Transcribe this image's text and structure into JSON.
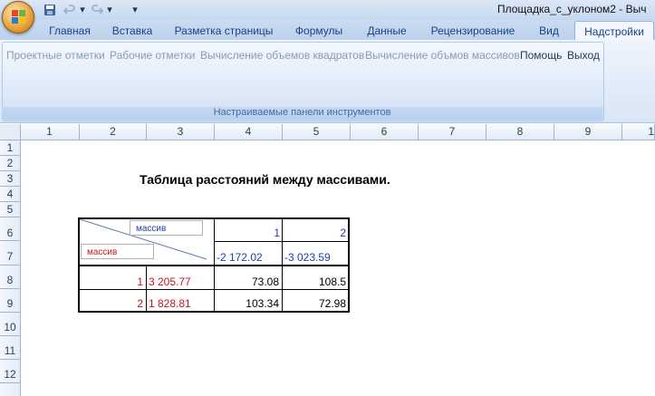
{
  "window": {
    "title": "Площадка_с_уклоном2 - Выч"
  },
  "quick_access": {
    "save_icon": "save-icon",
    "undo_icon": "undo-icon",
    "redo_icon": "redo-icon",
    "customize_icon": "chevron-down-icon"
  },
  "tabs": [
    {
      "label": "Главная",
      "active": false
    },
    {
      "label": "Вставка",
      "active": false
    },
    {
      "label": "Разметка страницы",
      "active": false
    },
    {
      "label": "Формулы",
      "active": false
    },
    {
      "label": "Данные",
      "active": false
    },
    {
      "label": "Рецензирование",
      "active": false
    },
    {
      "label": "Вид",
      "active": false
    },
    {
      "label": "Надстройки",
      "active": true
    }
  ],
  "ribbon": {
    "buttons": [
      {
        "label": "Проектные отметки",
        "enabled": false
      },
      {
        "label": "Рабочие отметки",
        "enabled": false
      },
      {
        "label": "Вычисление объемов квадратов",
        "enabled": false
      },
      {
        "label": "Вычисление объмов массивов",
        "enabled": false
      },
      {
        "label": "Помощь",
        "enabled": true
      },
      {
        "label": "Выход",
        "enabled": true
      }
    ],
    "group_label": "Настраиваемые панели инструментов"
  },
  "grid": {
    "columns": [
      "1",
      "2",
      "3",
      "4",
      "5",
      "6",
      "7",
      "8",
      "9",
      "1"
    ],
    "rows": [
      "1",
      "2",
      "3",
      "4",
      "5",
      "6",
      "7",
      "8",
      "9",
      "10",
      "11",
      "12"
    ]
  },
  "sheet": {
    "title": "Таблица расстояний между массивами.",
    "header_col_label": "массив",
    "header_row_label": "массив",
    "col_ids": [
      "1",
      "2"
    ],
    "col_values": [
      "-2 172.02",
      "-3 023.59"
    ],
    "rows": [
      {
        "id": "1",
        "value": "3 205.77",
        "cells": [
          "73.08",
          "108.5"
        ]
      },
      {
        "id": "2",
        "value": "1 828.81",
        "cells": [
          "103.34",
          "72.98"
        ]
      }
    ]
  },
  "colors": {
    "ribbon_text": "#15428b",
    "header_text": "#1f3ea8",
    "row_text": "#c8161d"
  }
}
